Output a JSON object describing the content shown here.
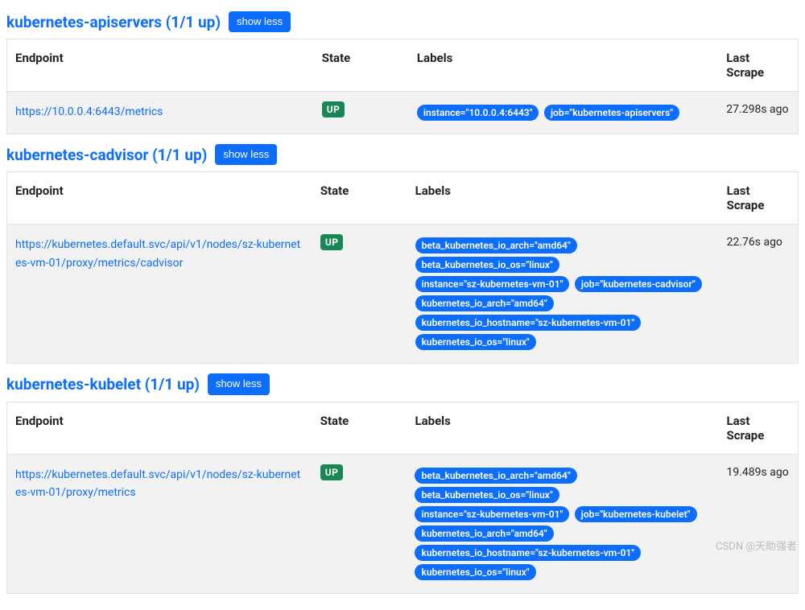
{
  "columns": {
    "endpoint": "Endpoint",
    "state": "State",
    "labels": "Labels",
    "last_scrape": "Last Scrape"
  },
  "show_less_label": "show less",
  "state_up_label": "UP",
  "watermark": "CSDN @天助强者",
  "groups": [
    {
      "title": "kubernetes-apiservers (1/1 up)",
      "targets": [
        {
          "endpoint": "https://10.0.0.4:6443/metrics",
          "state": "UP",
          "labels": [
            "instance=\"10.0.0.4:6443\"",
            "job=\"kubernetes-apiservers\""
          ],
          "last_scrape": "27.298s ago"
        }
      ]
    },
    {
      "title": "kubernetes-cadvisor (1/1 up)",
      "targets": [
        {
          "endpoint": "https://kubernetes.default.svc/api/v1/nodes/sz-kubernetes-vm-01/proxy/metrics/cadvisor",
          "state": "UP",
          "labels": [
            "beta_kubernetes_io_arch=\"amd64\"",
            "beta_kubernetes_io_os=\"linux\"",
            "instance=\"sz-kubernetes-vm-01\"",
            "job=\"kubernetes-cadvisor\"",
            "kubernetes_io_arch=\"amd64\"",
            "kubernetes_io_hostname=\"sz-kubernetes-vm-01\"",
            "kubernetes_io_os=\"linux\""
          ],
          "last_scrape": "22.76s ago"
        }
      ]
    },
    {
      "title": "kubernetes-kubelet (1/1 up)",
      "targets": [
        {
          "endpoint": "https://kubernetes.default.svc/api/v1/nodes/sz-kubernetes-vm-01/proxy/metrics",
          "state": "UP",
          "labels": [
            "beta_kubernetes_io_arch=\"amd64\"",
            "beta_kubernetes_io_os=\"linux\"",
            "instance=\"sz-kubernetes-vm-01\"",
            "job=\"kubernetes-kubelet\"",
            "kubernetes_io_arch=\"amd64\"",
            "kubernetes_io_hostname=\"sz-kubernetes-vm-01\"",
            "kubernetes_io_os=\"linux\""
          ],
          "last_scrape": "19.489s ago"
        }
      ]
    }
  ]
}
